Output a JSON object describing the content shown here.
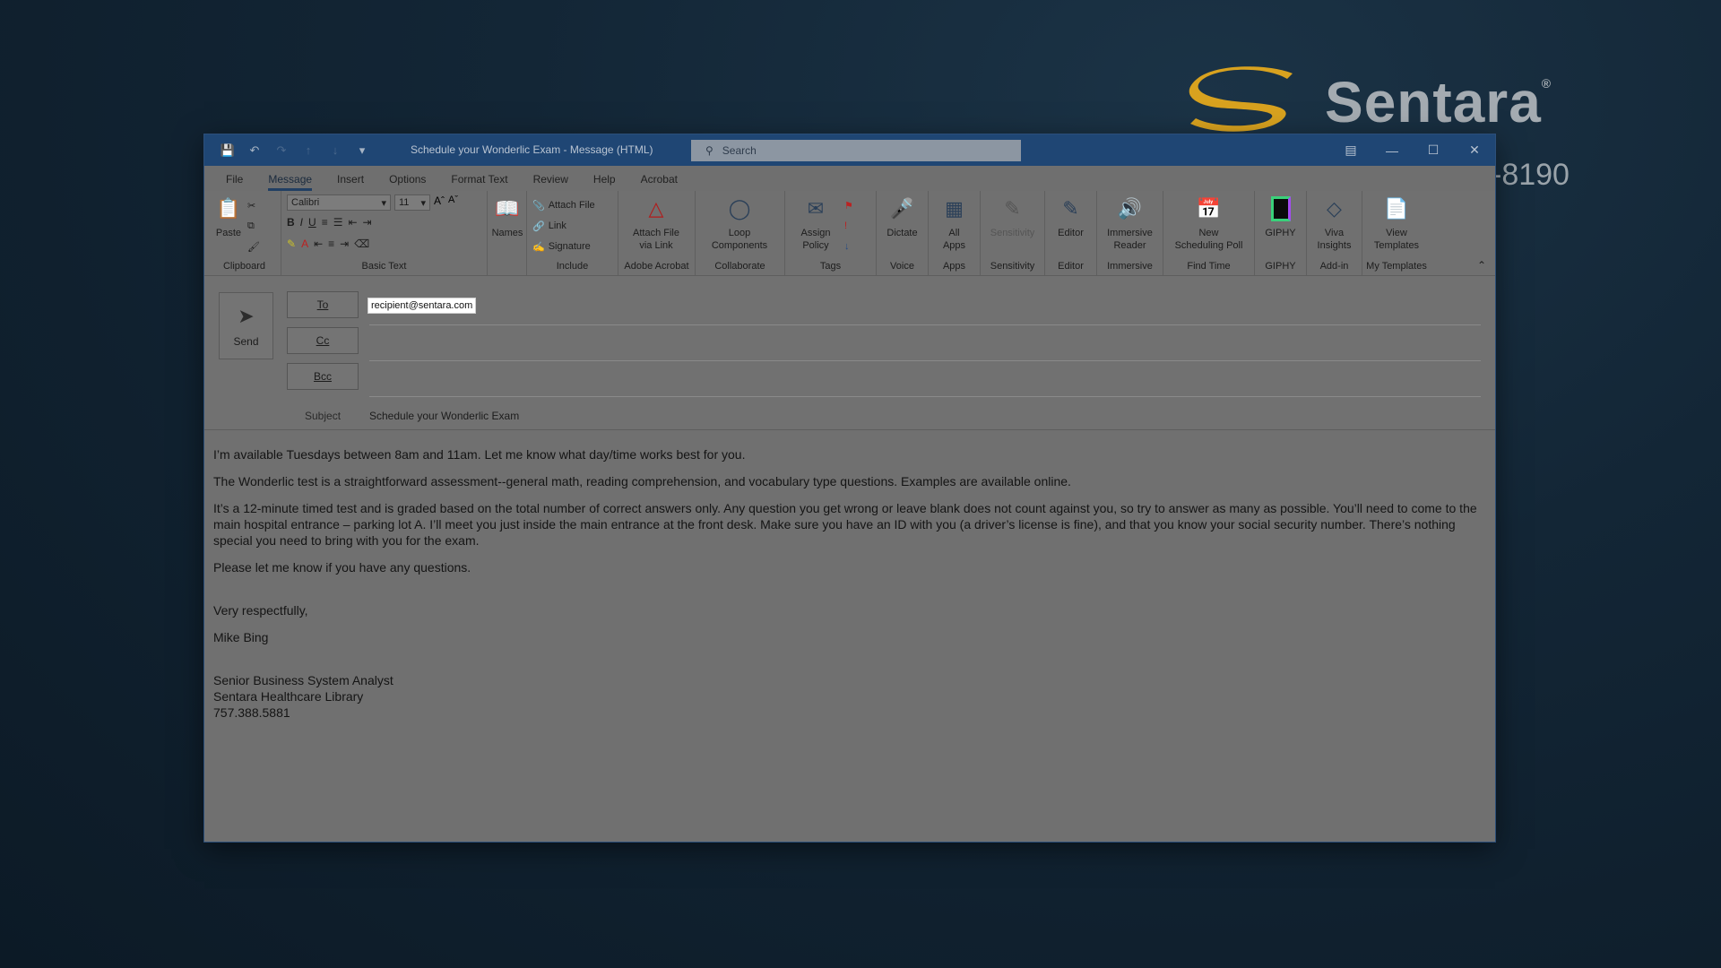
{
  "desktop": {
    "brand_name": "Sentara",
    "brand_mark": "®",
    "phone_fragment": "-8190"
  },
  "window": {
    "title": "Schedule your Wonderlic Exam  -  Message (HTML)",
    "search_placeholder": "Search"
  },
  "menu_tabs": [
    "File",
    "Message",
    "Insert",
    "Options",
    "Format Text",
    "Review",
    "Help",
    "Acrobat"
  ],
  "ribbon": {
    "clipboard": {
      "paste": "Paste",
      "label": "Clipboard"
    },
    "basic_text": {
      "font": "Calibri",
      "size": "11",
      "bold": "B",
      "italic": "I",
      "underline": "U",
      "label": "Basic Text"
    },
    "names": {
      "label": "Names"
    },
    "include": {
      "attach_file": "Attach File",
      "link": "Link",
      "signature": "Signature",
      "label": "Include"
    },
    "adobe": {
      "line1": "Attach File",
      "line2": "via Link",
      "label": "Adobe Acrobat"
    },
    "collaborate": {
      "line1": "Loop",
      "line2": "Components",
      "label": "Collaborate"
    },
    "tags": {
      "line1": "Assign",
      "line2": "Policy",
      "label": "Tags"
    },
    "voice": {
      "button": "Dictate",
      "label": "Voice"
    },
    "apps": {
      "line1": "All",
      "line2": "Apps",
      "label": "Apps"
    },
    "sensitivity": {
      "button": "Sensitivity",
      "label": "Sensitivity"
    },
    "editor": {
      "button": "Editor",
      "label": "Editor"
    },
    "immersive": {
      "line1": "Immersive",
      "line2": "Reader",
      "label": "Immersive"
    },
    "findtime": {
      "line1": "New",
      "line2": "Scheduling Poll",
      "label": "Find Time"
    },
    "giphy": {
      "button": "GIPHY",
      "label": "GIPHY"
    },
    "addin": {
      "line1": "Viva",
      "line2": "Insights",
      "label": "Add-in"
    },
    "templates": {
      "line1": "View",
      "line2": "Templates",
      "label": "My Templates"
    }
  },
  "compose": {
    "send": "Send",
    "to_label": "To",
    "cc_label": "Cc",
    "bcc_label": "Bcc",
    "to_value": "recipient@sentara.com",
    "subject_label": "Subject",
    "subject_value": "Schedule your Wonderlic Exam"
  },
  "body": {
    "p1": "I’m available Tuesdays between 8am and 11am. Let me know what day/time works best for you.",
    "p2": "The Wonderlic test is a straightforward assessment--general math, reading comprehension, and vocabulary type questions. Examples are available online.",
    "p3": "It’s a 12-minute timed test and is graded based on the total number of correct answers only. Any question you get wrong or leave blank does not count against you, so try to answer as many as possible. You’ll need to come to the main hospital entrance – parking lot A. I’ll meet you just inside the main entrance at the front desk. Make sure you have an ID with you (a driver’s license is fine), and that you know your social security number. There’s nothing special you need to bring with you for the exam.",
    "p4": "Please let me know if you have any questions.",
    "closing": "Very respectfully,",
    "name": "Mike Bing",
    "sig_title": "Senior Business System Analyst",
    "sig_org": "Sentara Healthcare Library",
    "sig_phone": "757.388.5881"
  }
}
